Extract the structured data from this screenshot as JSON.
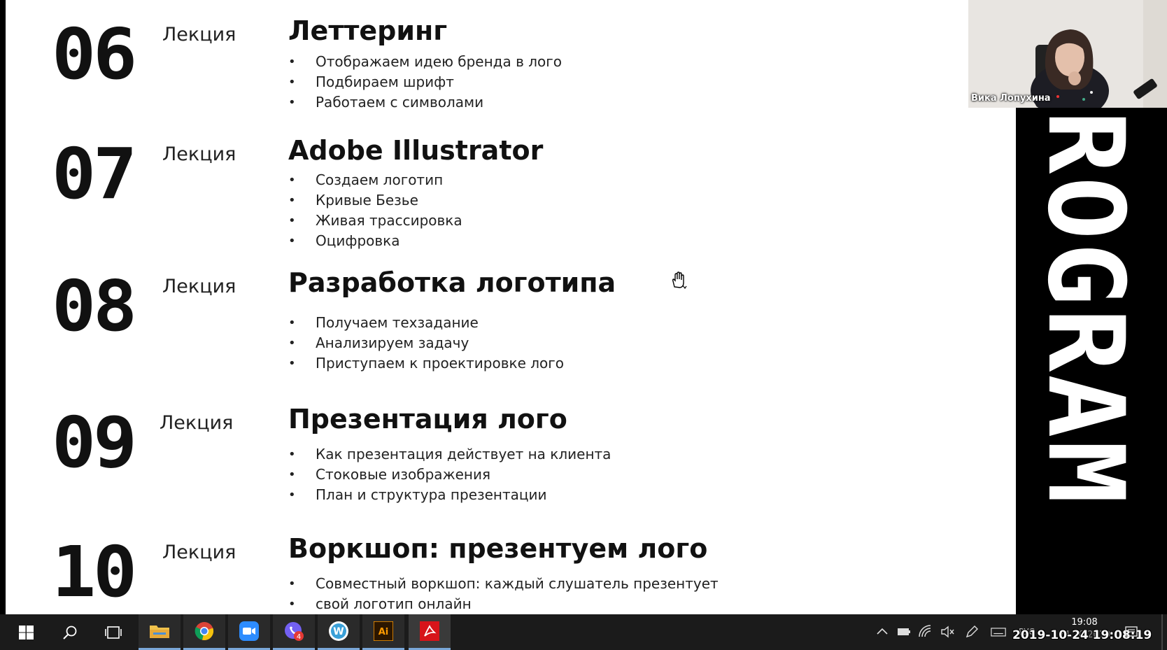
{
  "slide": {
    "lectures": [
      {
        "number": "06",
        "label": "Лекция",
        "title": "Леттеринг",
        "bullets": [
          "Отображаем идею бренда в лого",
          "Подбираем шрифт",
          "Работаем с символами"
        ]
      },
      {
        "number": "07",
        "label": "Лекция",
        "title": "Adobe Illustrator",
        "bullets": [
          "Создаем логотип",
          "Кривые Безье",
          "Живая трассировка",
          "Оцифровка"
        ]
      },
      {
        "number": "08",
        "label": "Лекция",
        "title": "Разработка логотипа",
        "bullets": [
          "Получаем техзадание",
          "Анализируем задачу",
          "Приступаем к проектировке лого"
        ]
      },
      {
        "number": "09",
        "label": "Лекция",
        "title": "Презентация лого",
        "bullets": [
          "Как презентация действует на клиента",
          "Стоковые изображения",
          "План и структура презентации"
        ]
      },
      {
        "number": "10",
        "label": "Лекция",
        "title": "Воркшоп: презентуем лого",
        "bullets": [
          "Совместный воркшоп: каждый слушатель презентует",
          "свой логотип онлайн"
        ]
      }
    ]
  },
  "brand_strip": {
    "text": "ROGRAM"
  },
  "webcam": {
    "participant_name": "Вика Лопухина"
  },
  "taskbar": {
    "apps": [
      {
        "name": "file-explorer",
        "icon": "folder-icon",
        "active": true
      },
      {
        "name": "chrome",
        "icon": "chrome-icon",
        "active": true
      },
      {
        "name": "zoom",
        "icon": "zoom-icon",
        "active": true
      },
      {
        "name": "viber",
        "icon": "viber-icon",
        "active": true,
        "badge": "4"
      },
      {
        "name": "whatsapp-like",
        "icon": "w-icon",
        "active": true,
        "label": "W"
      },
      {
        "name": "illustrator",
        "icon": "illustrator-icon",
        "active": true,
        "label": "Ai"
      },
      {
        "name": "acrobat",
        "icon": "acrobat-icon",
        "active": true
      }
    ],
    "tray": {
      "lang": "РУС",
      "time": "19:08",
      "date": "24.10.2019"
    }
  },
  "overlay": {
    "timestamp": "2019-10-24 19:08:19"
  },
  "colors": {
    "slide_bg": "#ffffff",
    "text": "#111111",
    "taskbar_bg": "#1b1b1b",
    "active_underline": "#7aa7d8"
  }
}
